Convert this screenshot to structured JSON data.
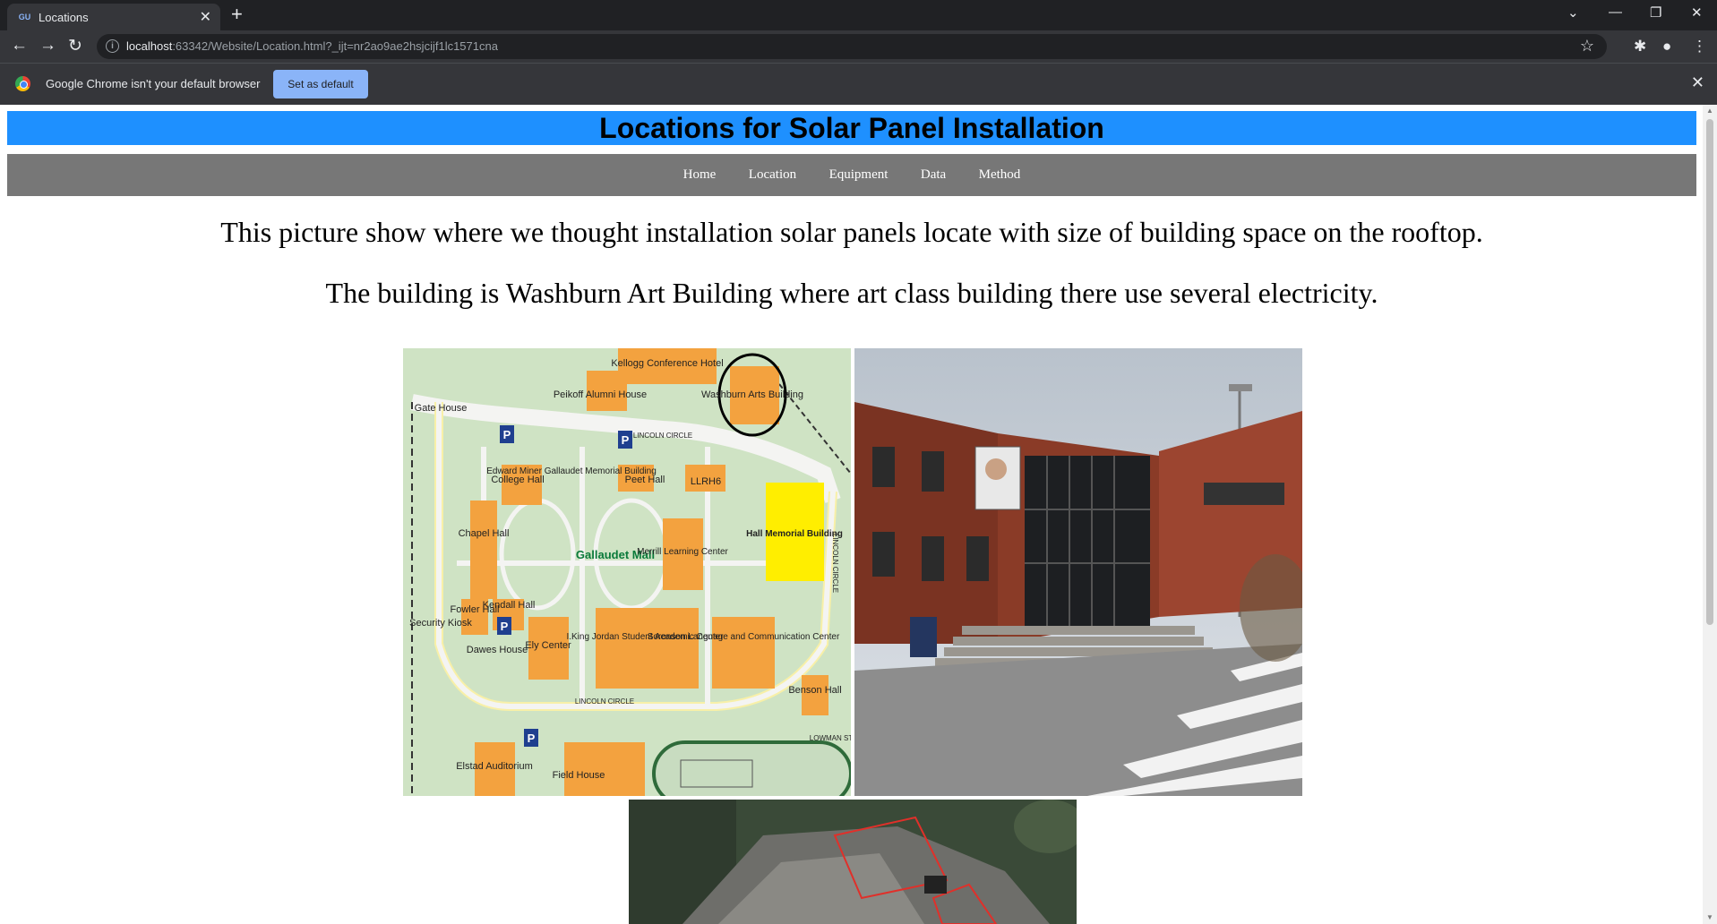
{
  "browser": {
    "tab_title": "Locations",
    "tab_favicon": "GU",
    "url_host": "localhost",
    "url_rest": ":63342/Website/Location.html?_ijt=nr2ao9ae2hsjcijf1lc1571cna",
    "infobar_text": "Google Chrome isn't your default browser",
    "set_default_label": "Set as default"
  },
  "page": {
    "title": "Locations for Solar Panel Installation",
    "nav": [
      "Home",
      "Location",
      "Equipment",
      "Data",
      "Method"
    ],
    "paragraphs": [
      "This picture show where we thought installation solar panels locate with size of building space on the rooftop.",
      "The building is Washburn Art Building where art class building there use several electricity."
    ]
  },
  "map": {
    "labels": {
      "kellogg": "Kellogg Conference Hotel",
      "peikoff": "Peikoff Alumni House",
      "washburn": "Washburn Arts Building",
      "gate": "Gate House",
      "lincoln_top": "LINCOLN CIRCLE",
      "college": "College Hall",
      "edward": "Edward Miner Gallaudet Memorial Building",
      "peet": "Peet Hall",
      "llrh6": "LLRH6",
      "hall_memorial": "Hall Memorial Building",
      "chapel": "Chapel Hall",
      "mall": "Gallaudet Mall",
      "merrill": "Merrill Learning Center",
      "fowler": "Fowler Hall",
      "kendall": "Kendall Hall",
      "security": "Security Kiosk",
      "dawes": "Dawes House",
      "ely": "Ely Center",
      "jordan": "I.King Jordan Student Academic Center",
      "sorenson": "Sorenson Language and Communication Center",
      "benson": "Benson Hall",
      "lincoln_bottom": "LINCOLN CIRCLE",
      "lowman": "LOWMAN ST",
      "elstad": "Elstad Auditorium",
      "field": "Field House",
      "lincoln_right": "LINCOLN CIRCLE"
    },
    "colors": {
      "ground": "#cfe3c4",
      "road": "#f4f4f2",
      "building": "#f3a23f",
      "highlight": "#ffee00",
      "parking": "#1f3f8f"
    }
  }
}
